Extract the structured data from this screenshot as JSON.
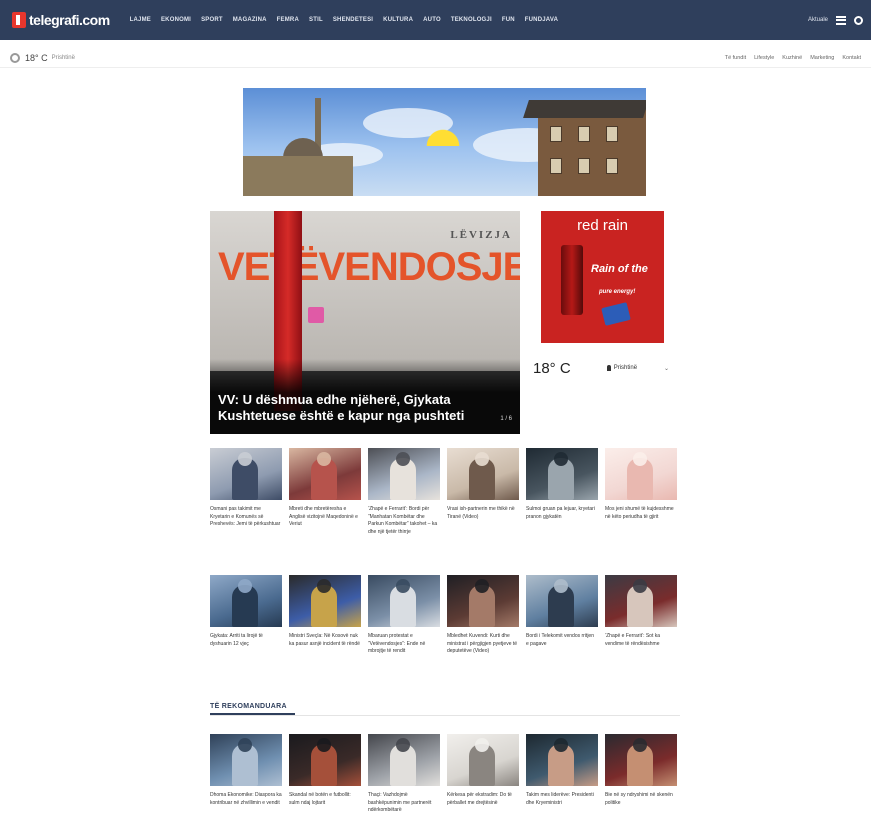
{
  "header": {
    "logo_text": "telegrafi.com",
    "nav": [
      "LAJME",
      "EKONOMI",
      "SPORT",
      "MAGAZINA",
      "FEMRA",
      "STIL",
      "SHENDETESI",
      "KULTURA",
      "AUTO",
      "TEKNOLOGJI",
      "FUN",
      "FUNDJAVA"
    ],
    "right_label": "Aktuale"
  },
  "subbar": {
    "temperature": "18° C",
    "city": "Prishtinë",
    "links": [
      "Të fundit",
      "Lifestyle",
      "Kuzhinë",
      "Marketing",
      "Kontakt"
    ]
  },
  "hero": {
    "title": "VV: U dëshmua edhe njëherë, Gjykata Kushtetuese është e kapur nga pushteti",
    "wall_text": "VETËVENDOSJE!",
    "wall_text_2": "LËVIZJA",
    "counter": "1 / 6"
  },
  "ad": {
    "title": "red rain",
    "slogan": "Rain of the",
    "slogan_2": "pure energy!"
  },
  "weather": {
    "temperature": "18° C",
    "location": "Prishtinë",
    "caret": "⌄"
  },
  "articles_row1": [
    {
      "caption": "Osmani pas takimit me Kryetarin e Komunës së Preshevës: Jemi të përkushtuar",
      "palette": [
        "#8e9bb0",
        "#3e4c66",
        "#c9cdd4"
      ]
    },
    {
      "caption": "Mbreti dhe mbretëresha e Anglisë vizitojnë Maqedoninë e Veriut",
      "palette": [
        "#7d3a3a",
        "#b6534c",
        "#d9b7a1"
      ]
    },
    {
      "caption": "‘Zhapë e Ferrarit’: Bordi për “Manhatan Kombëtar dhe Parkun Kombëtar” takohet – ka dhe një tjetër thirrje",
      "palette": [
        "#aab6c7",
        "#e7e2dc",
        "#4d4f55"
      ]
    },
    {
      "caption": "Vrasi ish-partnerin me thikë në Tiranë (Video)",
      "palette": [
        "#c9b9a8",
        "#6f5a4c",
        "#e8ddd2"
      ]
    },
    {
      "caption": "Sulmoi gruan pa lejuar, kryetari pranon gjykatën",
      "palette": [
        "#48555f",
        "#9aa5ad",
        "#1f2a33"
      ]
    },
    {
      "caption": "Mos jeni shumë të kujdesshme në këto periudha të gjirit",
      "palette": [
        "#f2d7d3",
        "#e9b8b0",
        "#fbeeea"
      ]
    }
  ],
  "articles_row2": [
    {
      "caption": "Gjykata: Arriti ta lirojë të dyshuarin 12 vjeç",
      "palette": [
        "#4a6a8f",
        "#263a52",
        "#8fa9c8"
      ]
    },
    {
      "caption": "Ministri Sveçla: Në Kosovë nuk ka pasur asnjë incident të rëndë",
      "palette": [
        "#3d5da8",
        "#c7a34a",
        "#2a2a2a"
      ]
    },
    {
      "caption": "Mbaruan protestat e “Vetëvendosjes”: Ende në mbrojtje të rendit",
      "palette": [
        "#7b8fa7",
        "#d9dde2",
        "#394b61"
      ]
    },
    {
      "caption": "Mbledhet Kuvendi: Kurti dhe ministrat i përgjigjen pyetjeve të deputetëve (Video)",
      "palette": [
        "#5c3b34",
        "#a47a68",
        "#1f1f24"
      ]
    },
    {
      "caption": "Bordi i Telekomit vendos rritjen e pagave",
      "palette": [
        "#5f7fa0",
        "#2d3c4f",
        "#aebdcb"
      ]
    },
    {
      "caption": "‘Zhapë e Ferrarit’: Sot ka vendime të rëndësishme",
      "palette": [
        "#7a2c2c",
        "#d7c6bc",
        "#3b3b44"
      ]
    }
  ],
  "section": {
    "title": "TË REKOMANDUARA"
  },
  "articles_row3": [
    {
      "caption": "Dhoma Ekonomike: Diaspora ka kontribuar në zhvillimin e vendit",
      "palette": [
        "#6f8fb0",
        "#aebfd2",
        "#2f4158"
      ]
    },
    {
      "caption": "Skandal në botën e futbollit: sulm ndaj lojtarit",
      "palette": [
        "#3a2a28",
        "#a5503a",
        "#1a1a1e"
      ]
    },
    {
      "caption": "Thaçi: Vazhdojmë bashkëpunimin me partnerët ndërkombëtarë",
      "palette": [
        "#9ea2a8",
        "#e1dfdc",
        "#44464c"
      ]
    },
    {
      "caption": "Kërkesa për ekstradim: Do të përballet me drejtësinë",
      "palette": [
        "#d8d5d0",
        "#8a8580",
        "#f1efec"
      ]
    },
    {
      "caption": "Takim mes liderëve: Presidenti dhe Kryeministri",
      "palette": [
        "#3f5a6e",
        "#c79c86",
        "#1d2830"
      ]
    },
    {
      "caption": "Bie në sy ndryshimi në skenën politike",
      "palette": [
        "#7b2b2b",
        "#c58f72",
        "#2a2a30"
      ]
    }
  ]
}
